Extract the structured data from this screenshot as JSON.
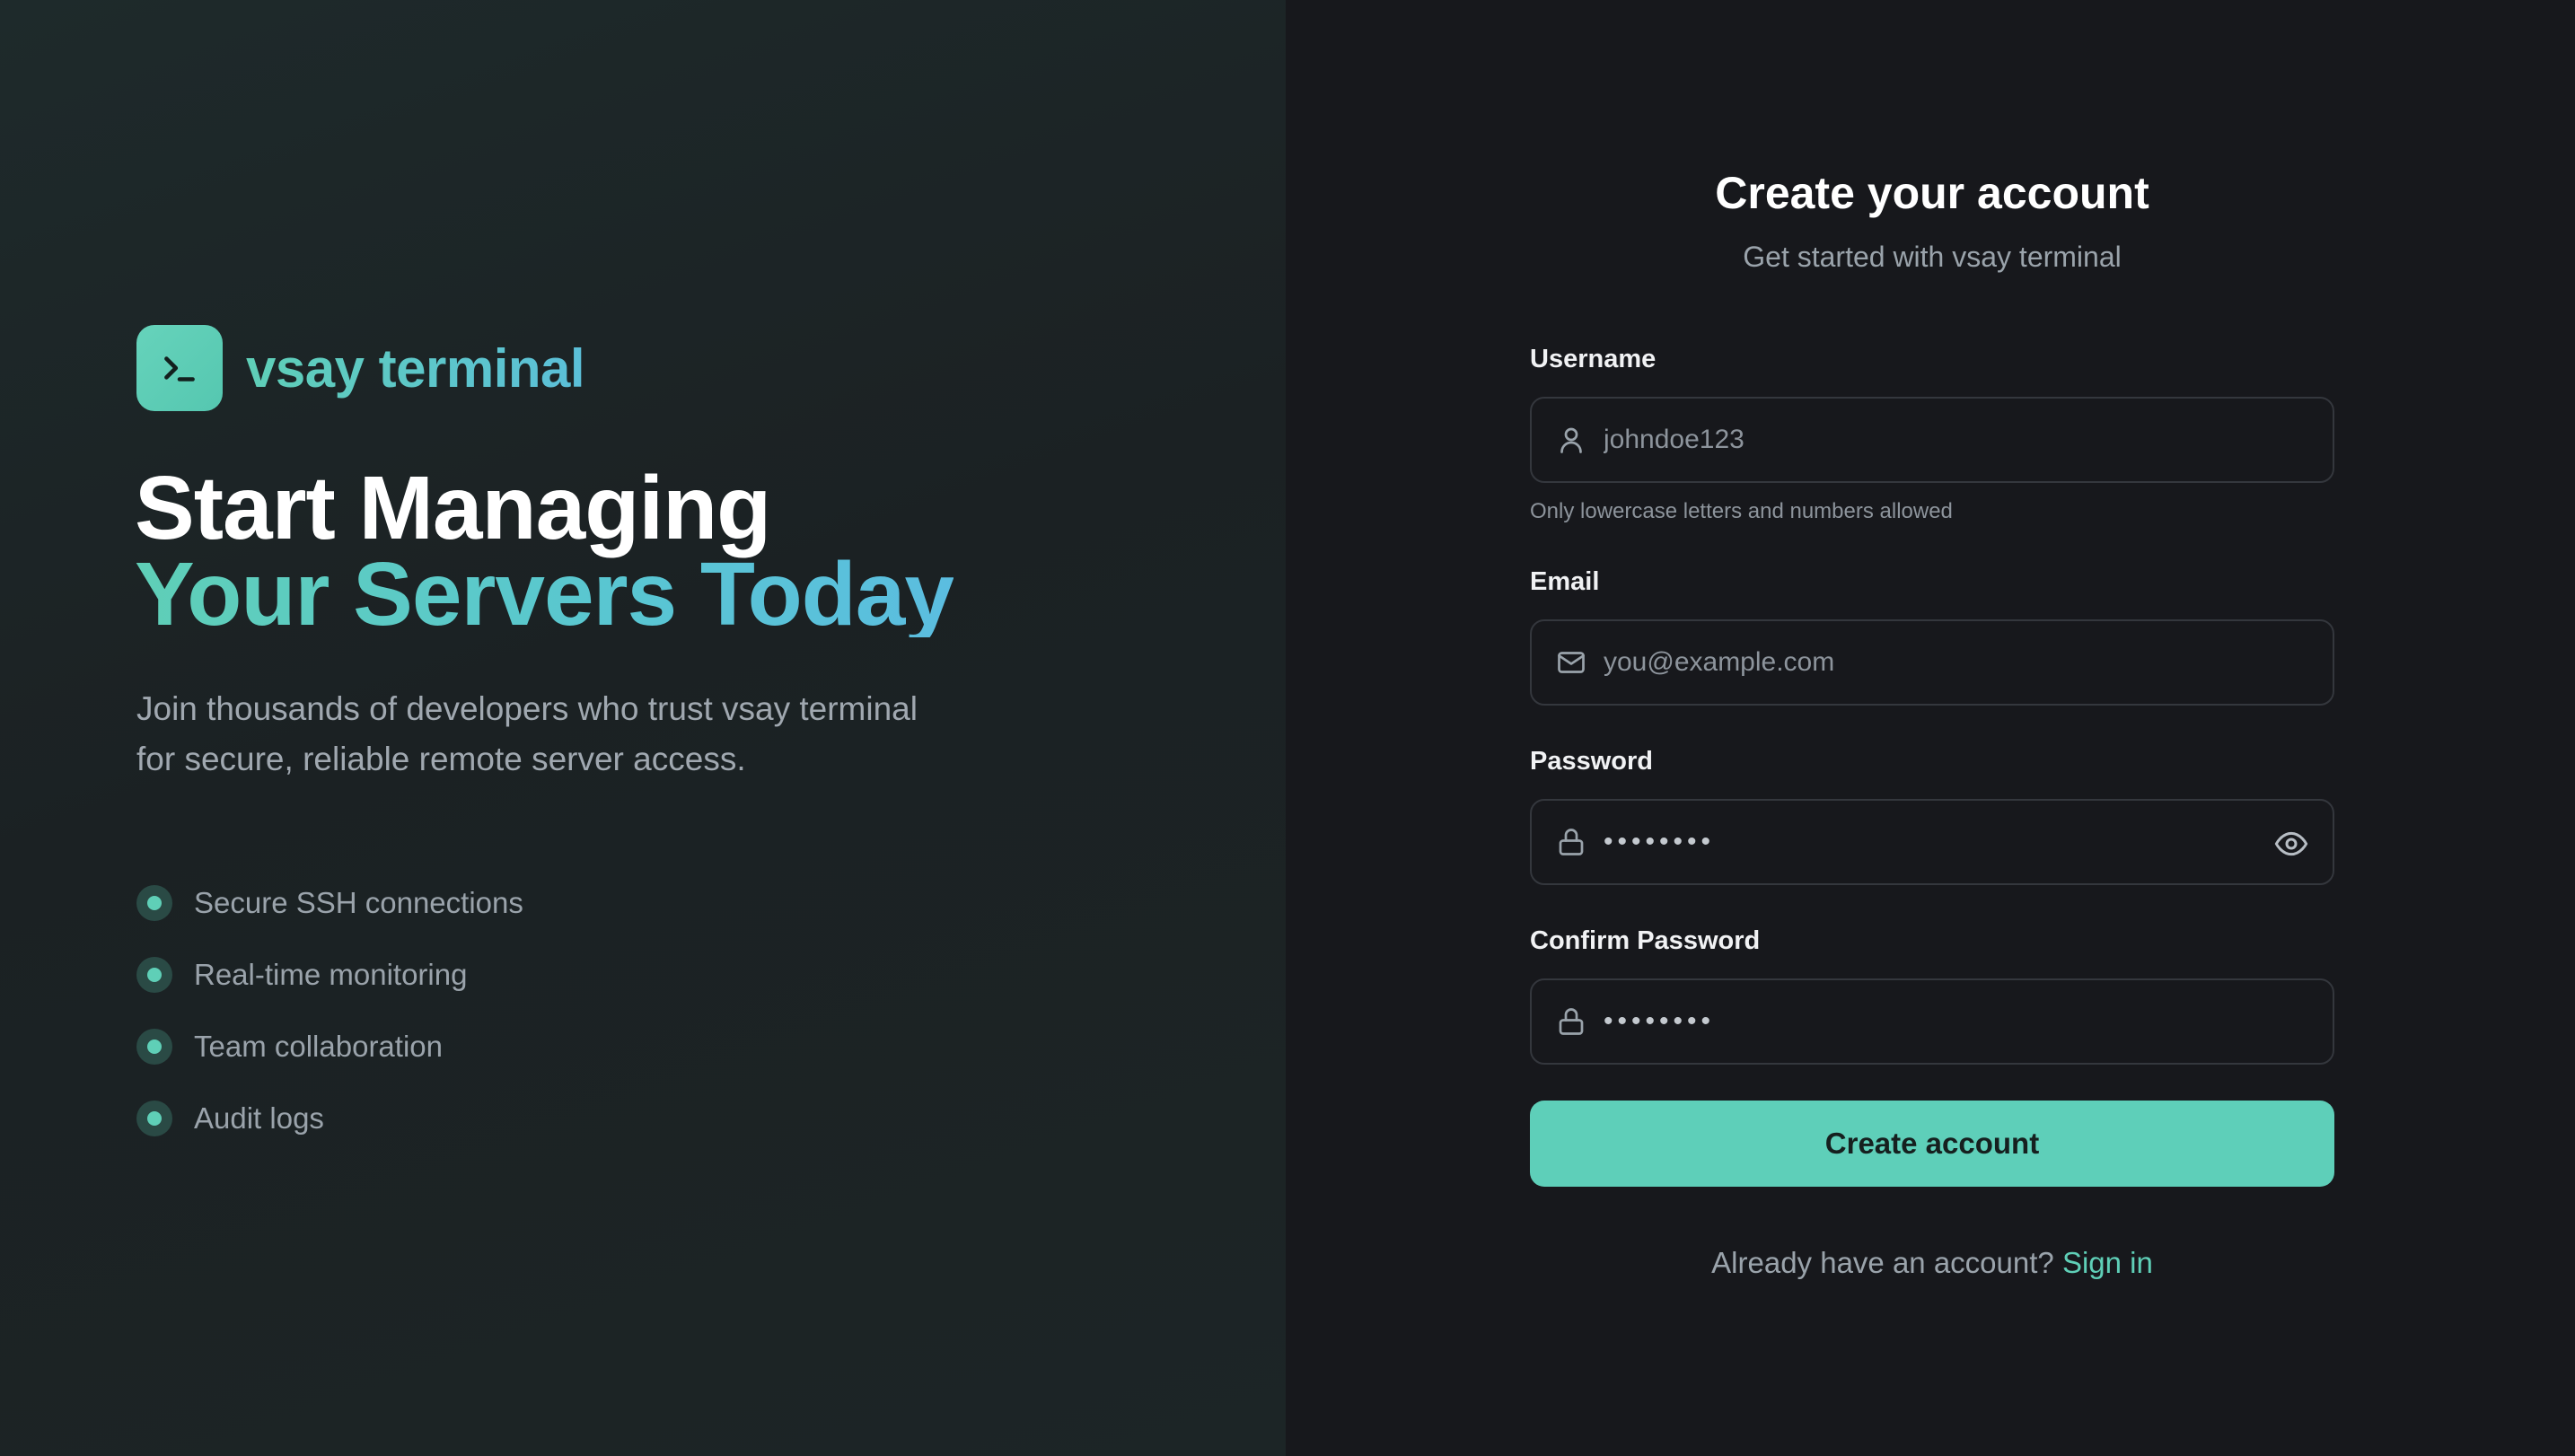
{
  "brand": {
    "name": "vsay terminal",
    "icon": "terminal-prompt-icon",
    "accent": "#5fcfb7"
  },
  "hero": {
    "line1": "Start Managing",
    "line2": "Your Servers Today",
    "lead": "Join thousands of developers who trust vsay terminal for secure, reliable remote server access."
  },
  "features": [
    {
      "label": "Secure SSH connections"
    },
    {
      "label": "Real-time monitoring"
    },
    {
      "label": "Team collaboration"
    },
    {
      "label": "Audit logs"
    }
  ],
  "form": {
    "title": "Create your account",
    "subtitle": "Get started with vsay terminal",
    "username": {
      "label": "Username",
      "placeholder": "johndoe123",
      "hint": "Only lowercase letters and numbers allowed",
      "icon": "user-icon"
    },
    "email": {
      "label": "Email",
      "placeholder": "you@example.com",
      "icon": "mail-icon"
    },
    "password": {
      "label": "Password",
      "masked_value": "••••••••",
      "icon": "lock-icon",
      "toggle_icon": "eye-icon"
    },
    "confirm_password": {
      "label": "Confirm Password",
      "masked_value": "••••••••",
      "icon": "lock-icon"
    },
    "submit_label": "Create account",
    "signin_prompt": "Already have an account?",
    "signin_link": "Sign in"
  },
  "colors": {
    "accent": "#5ecfb9",
    "left_bg": "#1c2426",
    "right_bg": "#17181c",
    "muted_text": "#9aa3ab"
  }
}
